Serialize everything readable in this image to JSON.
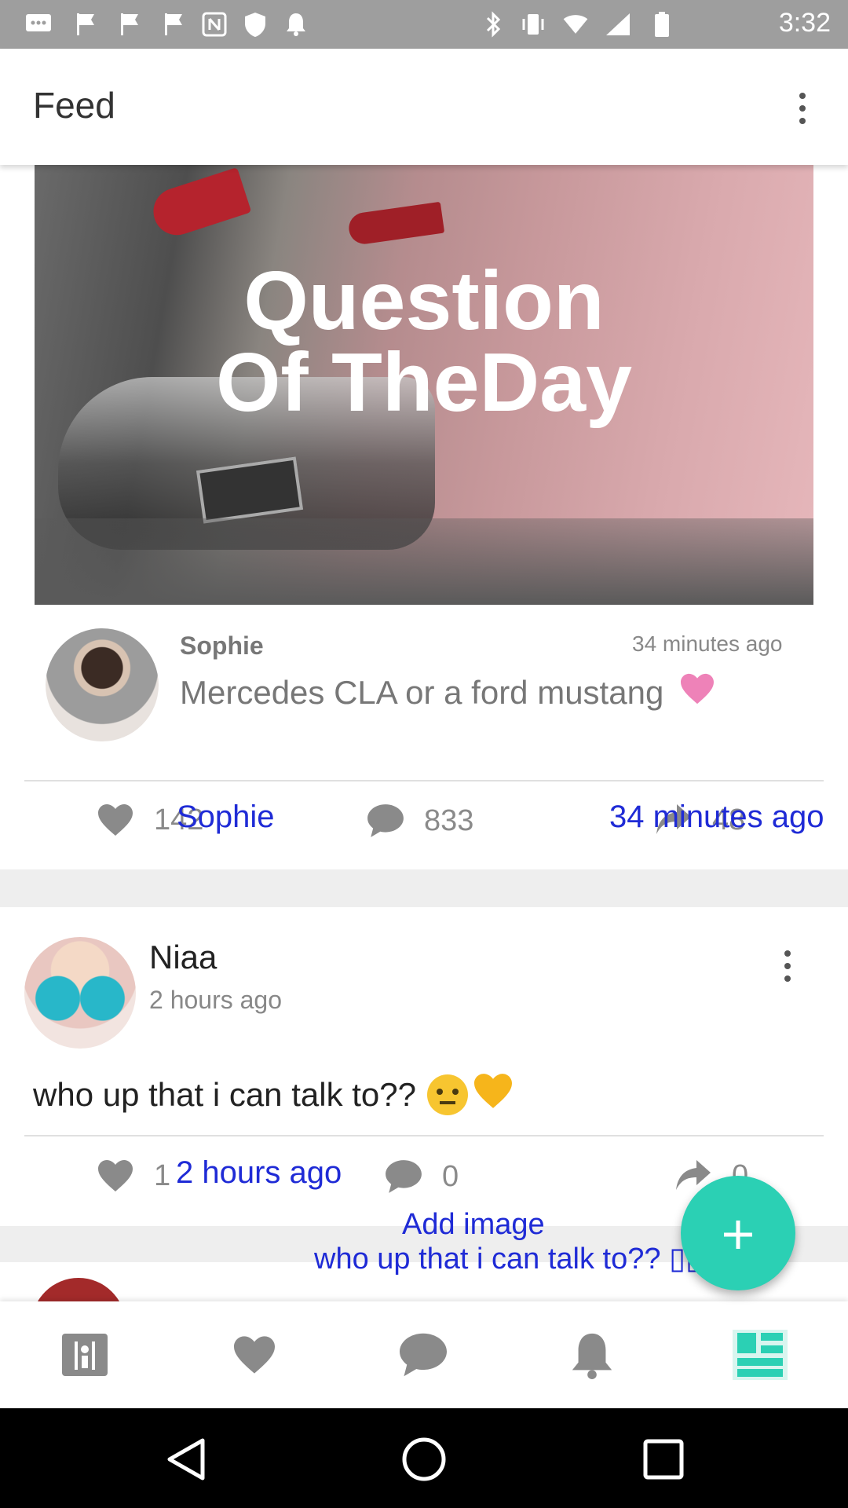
{
  "status_bar": {
    "time": "3:32",
    "icons": [
      "message-icon",
      "flag-icon",
      "flag-icon",
      "flag-icon",
      "nfc-icon",
      "shield-icon",
      "notification-bell-icon",
      "bluetooth-icon",
      "vibrate-icon",
      "wifi-icon",
      "signal-icon",
      "battery-icon"
    ]
  },
  "app_bar": {
    "title": "Feed",
    "menu_icon": "more-vert-icon"
  },
  "posts": [
    {
      "image_text_line1": "Question",
      "image_text_line2": "Of TheDay",
      "author": "Sophie",
      "time": "34 minutes ago",
      "message": "Mercedes CLA or a ford mustang",
      "message_emoji": "pink-heart",
      "likes": "142",
      "comments": "833",
      "shares": "48"
    },
    {
      "author": "Niaa",
      "time": "2 hours ago",
      "text": "who up that i can talk to??",
      "likes": "1",
      "comments": "0",
      "shares": "0"
    }
  ],
  "overlay_labels": {
    "sophie_name": "Sophie",
    "sophie_time": "34 minutes ago",
    "niaa_time": "2 hours ago",
    "fab_hint": "Add image",
    "niaa_text": "who up that i can talk to?? ▯▯"
  },
  "fab": {
    "icon": "plus-icon",
    "color": "#2bd0b4"
  },
  "bottom_nav": {
    "items": [
      "dashboard-icon",
      "heart-icon",
      "chat-icon",
      "bell-icon",
      "feed-icon"
    ],
    "active_index": 4,
    "active_color": "#2bd0b4"
  },
  "colors": {
    "overlay_blue": "#1f2bd6",
    "heart_pink": "#ee82b8"
  }
}
